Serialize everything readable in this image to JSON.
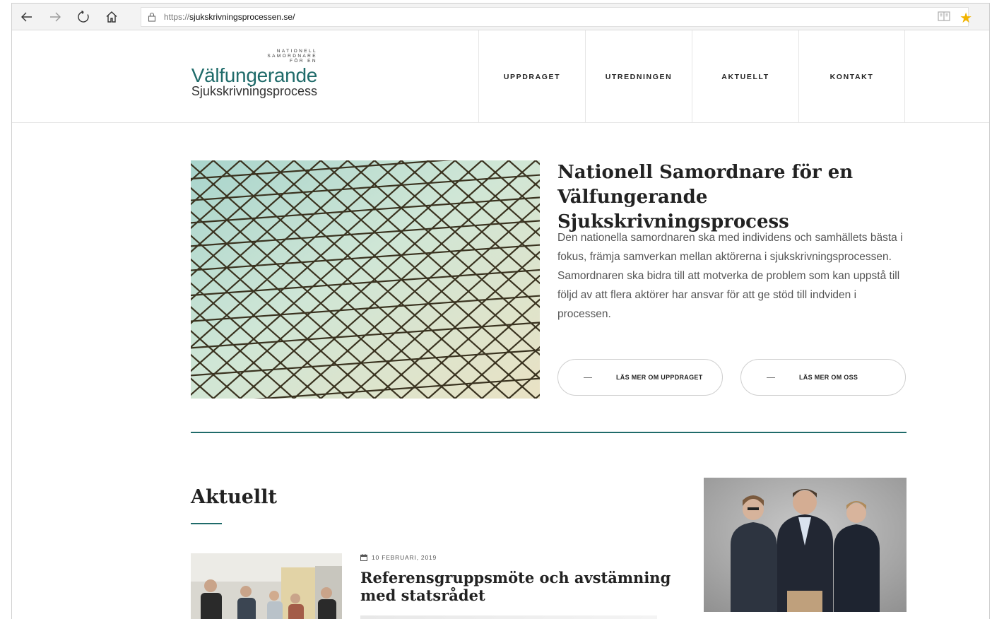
{
  "browser": {
    "url_protocol": "https://",
    "url_host": "sjukskrivningsprocessen.se/"
  },
  "site": {
    "logo_small_lines": [
      "NATIONELL",
      "SAMORDNARE",
      "FÖR EN"
    ],
    "logo_main": "Välfungerande",
    "logo_sub": "Sjukskrivningsprocess",
    "nav": [
      "UPPDRAGET",
      "UTREDNINGEN",
      "AKTUELLT",
      "KONTAKT"
    ],
    "accent_color": "#1f6b6a"
  },
  "hero": {
    "title": "Nationell Samordnare för en Välfungerande Sjukskrivningsprocess",
    "text": "Den nationella samordnaren ska med individens och samhällets bästa i fokus, främja samverkan mellan aktörerna i sjukskrivningsprocessen. Samordnaren ska bidra till att motverka de problem som kan uppstå till följd av att flera aktörer har ansvar för att ge stöd till indviden i processen.",
    "buttons": [
      "LÄS MER OM UPPDRAGET",
      "LÄS MER OM OSS"
    ]
  },
  "news": {
    "section_title": "Aktuellt",
    "date": "10 FEBRUARI, 2019",
    "title": "Referensgruppsmöte och avstämning med statsrådet"
  }
}
